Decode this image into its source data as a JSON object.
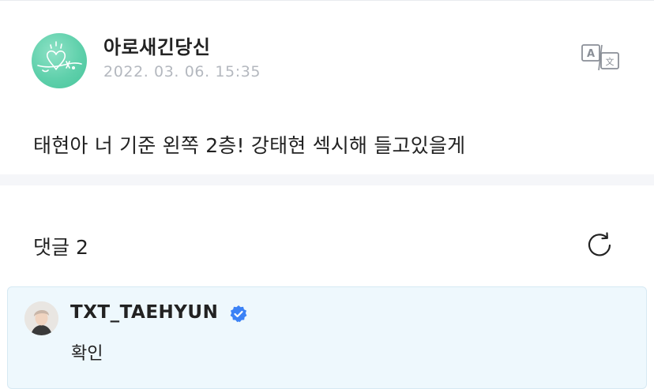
{
  "post": {
    "author": "아로새긴당신",
    "date": "2022. 03. 06. 15:35",
    "body": "태현아 너 기준 왼쪽 2층! 강태현 섹시해 들고있을게",
    "avatar_icon": "heart-doodle-icon",
    "translate_icon": "translate-icon"
  },
  "comments": {
    "title": "댓글 2",
    "refresh_icon": "refresh-icon",
    "items": [
      {
        "author": "TXT_TAEHYUN",
        "verified": true,
        "text": "확인"
      }
    ]
  },
  "colors": {
    "avatar_green": "#5fd0ab",
    "verified_blue": "#3b82f6",
    "comment_bg": "#eef8fd",
    "date_gray": "#b4b8bf",
    "divider": "#f5f6f9"
  }
}
